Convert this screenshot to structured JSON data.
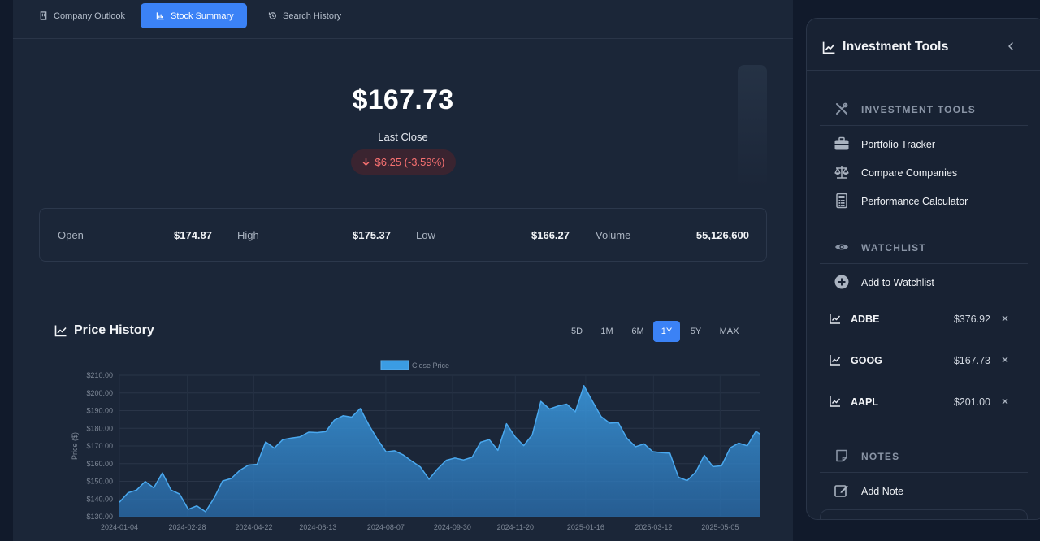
{
  "tabs": [
    {
      "label": "Company Outlook",
      "icon": "building-icon"
    },
    {
      "label": "Stock Summary",
      "icon": "bar-chart-icon"
    },
    {
      "label": "Search History",
      "icon": "history-icon"
    }
  ],
  "summary": {
    "price": "$167.73",
    "last_close_label": "Last Close",
    "change": "$6.25 (-3.59%)",
    "change_color": "#f87171"
  },
  "stats": [
    {
      "label": "Open",
      "value": "$174.87"
    },
    {
      "label": "High",
      "value": "$175.37"
    },
    {
      "label": "Low",
      "value": "$166.27"
    },
    {
      "label": "Volume",
      "value": "55,126,600"
    }
  ],
  "price_history": {
    "title": "Price History",
    "ranges": [
      "5D",
      "1M",
      "6M",
      "1Y",
      "5Y",
      "MAX"
    ],
    "active_range": "1Y"
  },
  "chart_data": {
    "type": "area",
    "legend": "Close Price",
    "legend_position": "top-center",
    "ylabel": "Price ($)",
    "xlabel": "",
    "ylim": [
      130,
      210
    ],
    "grid": true,
    "y_ticks": [
      "$130.00",
      "$140.00",
      "$150.00",
      "$160.00",
      "$170.00",
      "$180.00",
      "$190.00",
      "$200.00",
      "$210.00"
    ],
    "x_ticks": [
      "2024-01-04",
      "2024-02-28",
      "2024-04-22",
      "2024-06-13",
      "2024-08-07",
      "2024-09-30",
      "2024-11-20",
      "2025-01-16",
      "2025-03-12",
      "2025-05-05"
    ],
    "x": [
      "2024-01-04",
      "2024-01-11",
      "2024-01-18",
      "2024-01-25",
      "2024-02-01",
      "2024-02-08",
      "2024-02-15",
      "2024-02-22",
      "2024-02-28",
      "2024-03-07",
      "2024-03-14",
      "2024-03-21",
      "2024-03-28",
      "2024-04-05",
      "2024-04-12",
      "2024-04-19",
      "2024-04-22",
      "2024-04-29",
      "2024-05-06",
      "2024-05-13",
      "2024-05-20",
      "2024-05-28",
      "2024-06-04",
      "2024-06-13",
      "2024-06-20",
      "2024-06-27",
      "2024-07-05",
      "2024-07-12",
      "2024-07-19",
      "2024-07-26",
      "2024-08-02",
      "2024-08-07",
      "2024-08-14",
      "2024-08-21",
      "2024-08-28",
      "2024-09-05",
      "2024-09-12",
      "2024-09-19",
      "2024-09-26",
      "2024-09-30",
      "2024-10-07",
      "2024-10-14",
      "2024-10-21",
      "2024-10-28",
      "2024-11-04",
      "2024-11-11",
      "2024-11-20",
      "2024-11-27",
      "2024-12-05",
      "2024-12-12",
      "2024-12-19",
      "2024-12-27",
      "2025-01-03",
      "2025-01-10",
      "2025-01-16",
      "2025-01-24",
      "2025-01-31",
      "2025-02-07",
      "2025-02-14",
      "2025-02-21",
      "2025-02-28",
      "2025-03-07",
      "2025-03-12",
      "2025-03-19",
      "2025-03-26",
      "2025-04-02",
      "2025-04-09",
      "2025-04-16",
      "2025-04-23",
      "2025-04-30",
      "2025-05-05",
      "2025-05-12",
      "2025-05-19",
      "2025-05-27",
      "2025-06-03",
      "2025-06-10"
    ],
    "series": [
      {
        "name": "Close Price",
        "color": "#3b9ce3",
        "values": [
          138.2,
          143.5,
          145.1,
          149.9,
          146.3,
          154.8,
          145.1,
          142.8,
          134.2,
          136.1,
          132.8,
          140.5,
          150.2,
          151.6,
          156.2,
          159.2,
          159.6,
          172.3,
          168.8,
          173.6,
          174.5,
          175.2,
          177.8,
          177.6,
          178.2,
          184.7,
          187.1,
          186.3,
          191.2,
          181.9,
          173.8,
          166.7,
          167.3,
          164.9,
          161.4,
          158.1,
          151.2,
          157.1,
          161.9,
          163.2,
          162.1,
          163.6,
          172.1,
          173.6,
          167.5,
          182.6,
          175.2,
          170.2,
          176.4,
          195.2,
          190.9,
          192.6,
          193.7,
          189.3,
          204.1,
          195.2,
          186.6,
          182.9,
          183.2,
          174.3,
          169.6,
          171.2,
          166.8,
          166.2,
          165.9,
          152.3,
          150.4,
          155.2,
          164.7,
          158.3,
          158.8,
          168.9,
          171.6,
          170.1,
          178.3,
          174.9
        ]
      }
    ]
  },
  "sidebar": {
    "title": "Investment Tools",
    "tools_section": "INVESTMENT TOOLS",
    "tools": [
      {
        "label": "Portfolio Tracker",
        "icon": "briefcase-icon"
      },
      {
        "label": "Compare Companies",
        "icon": "scale-icon"
      },
      {
        "label": "Performance Calculator",
        "icon": "calculator-icon"
      }
    ],
    "watchlist_section": "WATCHLIST",
    "add_watchlist": "Add to Watchlist",
    "watchlist": [
      {
        "symbol": "ADBE",
        "price": "$376.92"
      },
      {
        "symbol": "GOOG",
        "price": "$167.73"
      },
      {
        "symbol": "AAPL",
        "price": "$201.00"
      }
    ],
    "notes_section": "NOTES",
    "add_note": "Add Note"
  },
  "colors": {
    "accent": "#3b82f6",
    "negative": "#f87171",
    "background": "#111a2b",
    "panel": "#1b2638"
  }
}
